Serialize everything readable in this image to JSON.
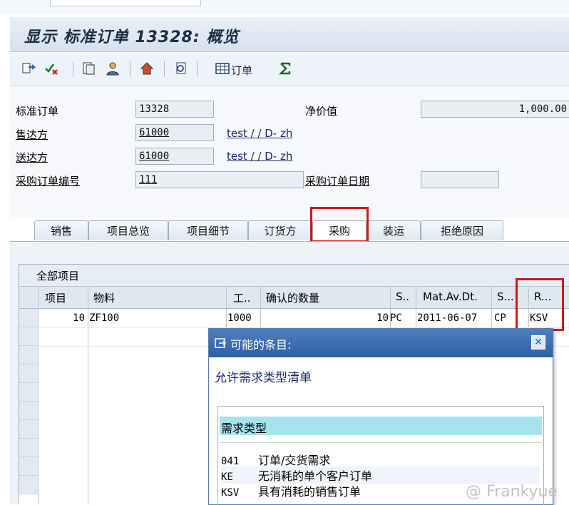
{
  "window": {
    "title": "显示 标准订单 13328: 概览"
  },
  "toolbar": {
    "order_label": "订单"
  },
  "header": {
    "order_label": "标准订单",
    "order_value": "13328",
    "net_value_label": "净价值",
    "net_value": "1,000.00",
    "sold_to_label": "售达方",
    "sold_to_value": "61000",
    "sold_to_link": "test / / D- zh",
    "ship_to_label": "送达方",
    "ship_to_value": "61000",
    "ship_to_link": "test / / D- zh",
    "po_number_label": "采购订单编号",
    "po_number_value": "111",
    "po_date_label": "采购订单日期",
    "po_date_value": ""
  },
  "tabs": [
    "销售",
    "项目总览",
    "项目细节",
    "订货方",
    "采购",
    "装运",
    "拒绝原因"
  ],
  "grid": {
    "title": "全部项目",
    "columns": [
      "项目",
      "物料",
      "工..",
      "确认的数量",
      "S..",
      "Mat.Av.Dt.",
      "S...",
      "R..."
    ],
    "rows": [
      {
        "item": "10",
        "material": "ZF100",
        "plant": "1000",
        "qty": "10",
        "unit": "PC",
        "date": "2011-06-07",
        "s": "CP",
        "r": "KSV"
      }
    ]
  },
  "popup": {
    "title": "可能的条目:",
    "subtitle": "允许需求类型清单",
    "list_header": "需求类型",
    "items": [
      {
        "code": "041",
        "text": "订单/交货需求"
      },
      {
        "code": "KE",
        "text": "无消耗的单个客户订单"
      },
      {
        "code": "KSV",
        "text": "具有消耗的销售订单"
      }
    ]
  },
  "watermark": "@ Frankyue",
  "colors": {
    "title_bar": "#2d5fa4",
    "highlight": "#a6e3ef",
    "annotation_red": "#d01818"
  }
}
